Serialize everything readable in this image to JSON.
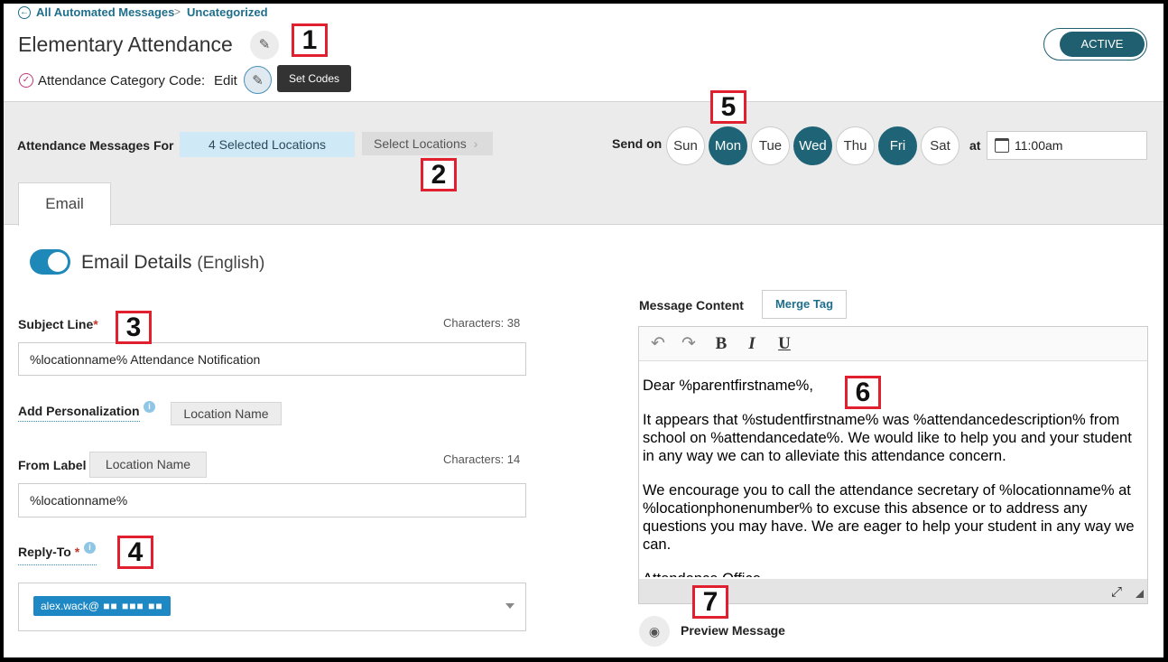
{
  "breadcrumb": {
    "back": "All Automated Messages",
    "sep": ">",
    "current": "Uncategorized"
  },
  "page": {
    "title": "Elementary Attendance",
    "category_label": "Attendance Category Code:",
    "category_edit": "Edit",
    "tooltip": "Set Codes",
    "status": "ACTIVE"
  },
  "config": {
    "messages_for_label": "Attendance Messages For",
    "selected_locations": "4 Selected Locations",
    "select_locations_btn": "Select Locations",
    "send_on_label": "Send on",
    "days": [
      {
        "label": "Sun",
        "selected": false
      },
      {
        "label": "Mon",
        "selected": true
      },
      {
        "label": "Tue",
        "selected": false
      },
      {
        "label": "Wed",
        "selected": true
      },
      {
        "label": "Thu",
        "selected": false
      },
      {
        "label": "Fri",
        "selected": true
      },
      {
        "label": "Sat",
        "selected": false
      }
    ],
    "at_label": "at",
    "time": "11:00am"
  },
  "tabs": {
    "email": "Email"
  },
  "email": {
    "details_title": "Email Details",
    "details_lang": "(English)",
    "subject": {
      "label": "Subject Line",
      "chars": "Characters: 38",
      "value": "%locationname% Attendance Notification"
    },
    "personalization": {
      "label": "Add Personalization",
      "chip": "Location Name"
    },
    "from": {
      "label": "From Label",
      "chip": "Location Name",
      "chars": "Characters: 14",
      "value": "%locationname%"
    },
    "reply_to": {
      "label": "Reply-To",
      "value": "alex.wack@"
    }
  },
  "editor": {
    "label": "Message Content",
    "merge_tag": "Merge Tag",
    "paragraphs": [
      "Dear %parentfirstname%,",
      "It appears that %studentfirstname% was %attendancedescription% from school on %attendancedate%.  We would like to help you and your student in any way we can to alleviate this attendance concern.",
      "We encourage you to call the attendance secretary of %locationname% at %locationphonenumber% to excuse this absence or to address any questions you may have.  We are eager to help your student in any way we can.",
      "Attendance Office"
    ],
    "preview": "Preview Message"
  },
  "callouts": [
    "1",
    "2",
    "3",
    "4",
    "5",
    "6",
    "7"
  ],
  "colors": {
    "accent": "#1f6476",
    "link": "#1f6e8c",
    "callout_border": "#e0202e"
  }
}
